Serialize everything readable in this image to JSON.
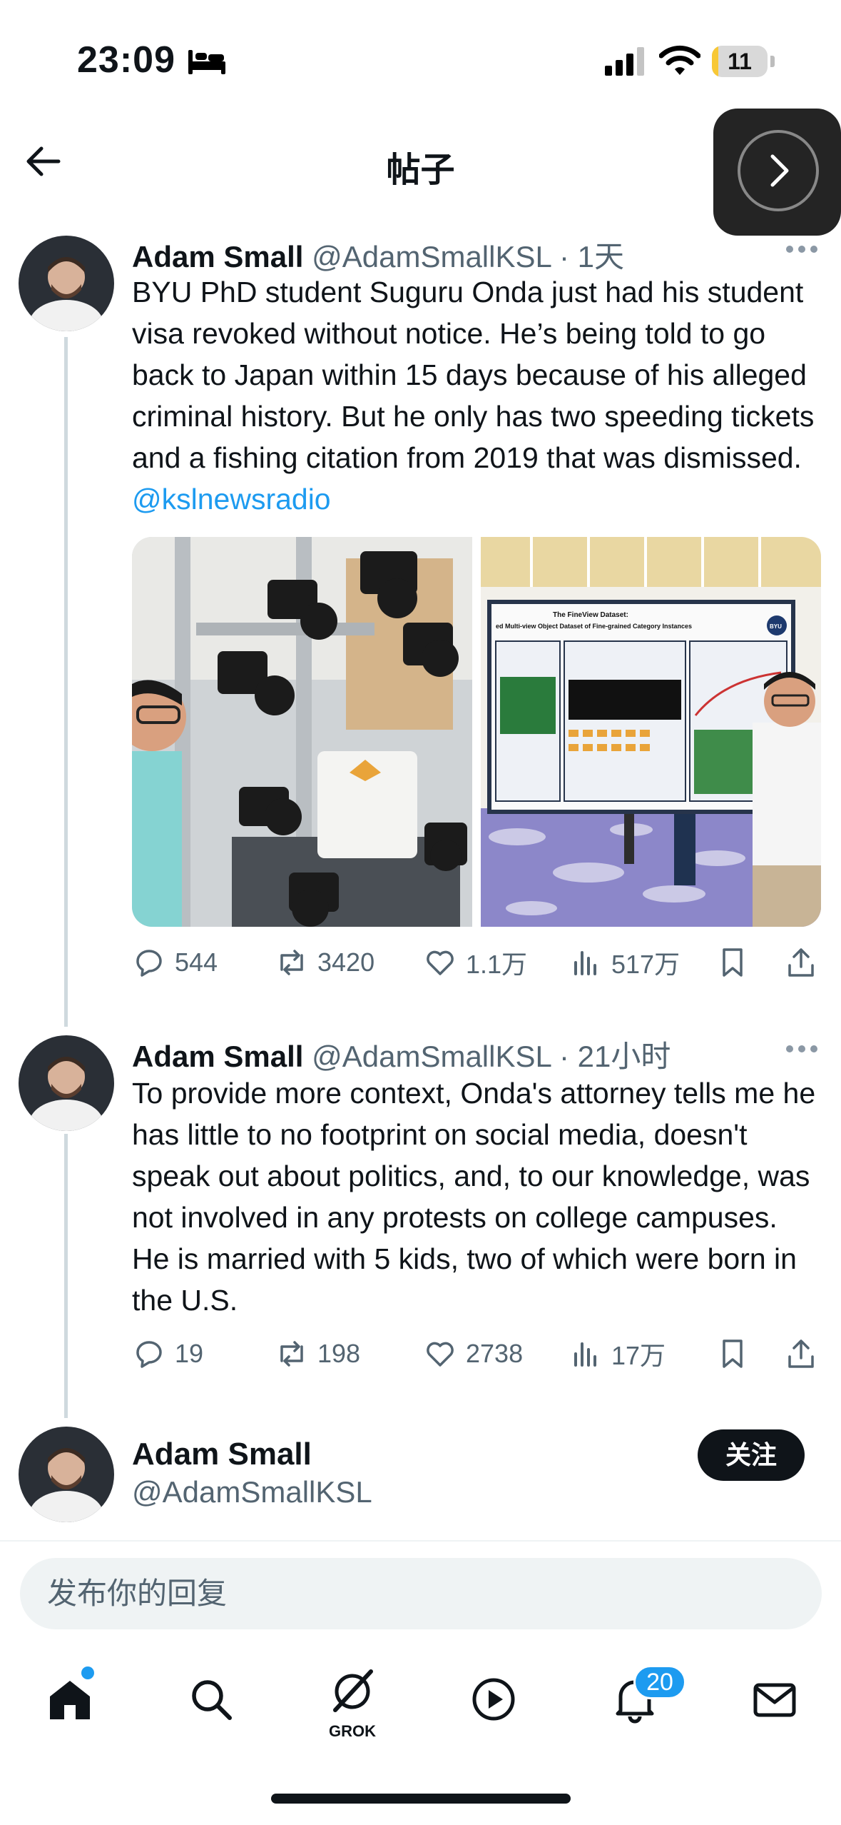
{
  "status_bar": {
    "time": "23:09",
    "battery": "11",
    "battery_level_percent": 11
  },
  "header": {
    "title": "帖子"
  },
  "tweets": [
    {
      "name": "Adam Small",
      "handle": "@AdamSmallKSL",
      "sep": "·",
      "time": "1天",
      "text": "BYU PhD student Suguru Onda just had his student visa revoked without notice. He’s being told to go back to Japan within 15 days because of his alleged criminal history. But he only has two speeding tickets and a fishing citation from 2019 that was dismissed. ",
      "mention": "@kslnewsradio",
      "stats": {
        "replies": "544",
        "reposts": "3420",
        "likes": "1.1万",
        "views": "517万"
      },
      "poster": {
        "title": "The FineView Dataset:",
        "subtitle": "ed Multi-view Object Dataset of Fine-grained Category Instances",
        "logo": "BYU"
      }
    },
    {
      "name": "Adam Small",
      "handle": "@AdamSmallKSL",
      "sep": "·",
      "time": "21小时",
      "text": "To provide more context, Onda's attorney tells me he has little to no footprint on social media, doesn't speak out about politics, and, to our knowledge, was not involved in any protests on college campuses. He is married with 5 kids, two of which were born in the U.S.",
      "stats": {
        "replies": "19",
        "reposts": "198",
        "likes": "2738",
        "views": "17万"
      }
    }
  ],
  "author_card": {
    "name": "Adam Small",
    "handle": "@AdamSmallKSL",
    "follow_label": "关注"
  },
  "reply": {
    "placeholder": "发布你的回复"
  },
  "tabbar": {
    "grok_label": "GROK",
    "notifications_badge": "20",
    "icons": [
      "home-icon",
      "search-icon",
      "grok-icon",
      "play-icon",
      "bell-icon",
      "mail-icon"
    ]
  },
  "colors": {
    "accent": "#1d9bf0",
    "text": "#0f1419",
    "muted": "#536471"
  }
}
